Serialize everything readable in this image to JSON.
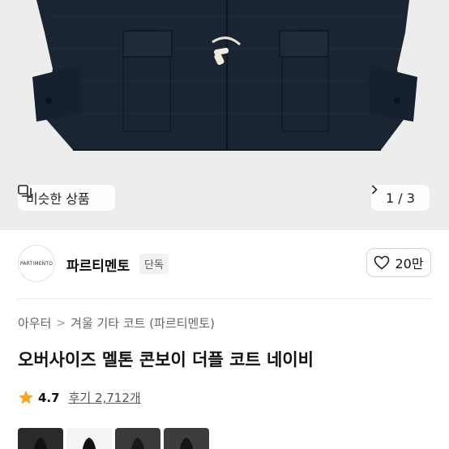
{
  "hero": {
    "similar_label": "비슷한 상품",
    "pager_label": "1 / 3",
    "similar_icon": "similar-items-icon",
    "next_icon": "chevron-right-icon"
  },
  "seller": {
    "logo_text": "PARTIMENTO",
    "name": "파르티멘토",
    "badge": "단독",
    "like_icon": "heart-outline-icon",
    "like_count": "20만"
  },
  "breadcrumb": [
    "아우터",
    "겨울 기타 코트 (파르티멘토)"
  ],
  "product": {
    "title": "오버사이즈 멜톤 콘보이 더플 코트 네이비"
  },
  "rating": {
    "star_color": "#f5a623",
    "score": "4.7",
    "reviews": "후기 2,712개"
  },
  "colors": {
    "coat": "#1a2332",
    "bg": "#ededed"
  }
}
